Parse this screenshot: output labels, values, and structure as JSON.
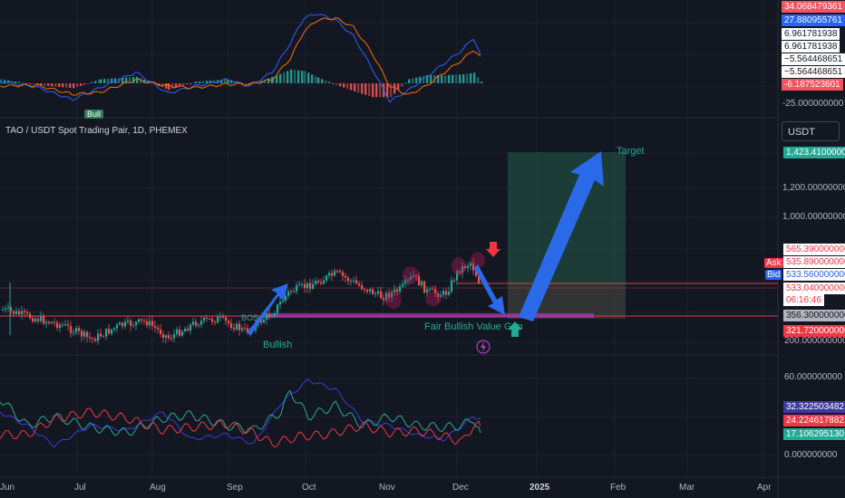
{
  "symbol_title": "TAO / USDT Spot Trading Pair, 1D, PHEMEX",
  "currency_button": "USDT",
  "macd_axis_tick": "-25.000000000",
  "price_axis_ticks": [
    "1,200.000000000",
    "1,000.000000000",
    "200.000000000"
  ],
  "rsi_axis_ticks": [
    "60.000000000",
    "0.000000000"
  ],
  "time_axis_labels": [
    "Jun",
    "Jul",
    "Aug",
    "Sep",
    "Oct",
    "Nov",
    "Dec",
    "2025",
    "Feb",
    "Mar",
    "Apr"
  ],
  "macd_labels": [
    {
      "text": "34.068479361",
      "bg": "#f7525f",
      "fg": "#ffffff"
    },
    {
      "text": "27.880955761",
      "bg": "#2962ff",
      "fg": "#ffffff"
    },
    {
      "text": "6.961781938",
      "bg": "#ffffff",
      "fg": "#131722"
    },
    {
      "text": "6.961781938",
      "bg": "#ffffff",
      "fg": "#131722"
    },
    {
      "text": "−5.564468651",
      "bg": "#ffffff",
      "fg": "#131722"
    },
    {
      "text": "−5.564468651",
      "bg": "#ffffff",
      "fg": "#131722"
    },
    {
      "text": "-6.187523601",
      "bg": "#f7525f",
      "fg": "#ffffff"
    }
  ],
  "price_labels": [
    {
      "text": "1,423.410000000",
      "bg": "#22ab94",
      "fg": "#ffffff"
    },
    {
      "text": "565.390000000",
      "bg": "#ffffff",
      "fg": "#f23645"
    },
    {
      "text": "535.890000000",
      "bg": "#ffffff",
      "fg": "#f23645"
    },
    {
      "text": "533.560000000",
      "bg": "#ffffff",
      "fg": "#2962ff"
    },
    {
      "text": "533.040000000",
      "bg": "#ffffff",
      "fg": "#f23645"
    },
    {
      "text": "06:16:46",
      "bg": "#ffffff",
      "fg": "#f23645"
    },
    {
      "text": "356.300000000",
      "bg": "#b2b5be",
      "fg": "#131722"
    },
    {
      "text": "321.720000000",
      "bg": "#f23645",
      "fg": "#ffffff"
    }
  ],
  "ask_tag": "Ask",
  "bid_tag": "Bid",
  "rsi_labels": [
    {
      "text": "32.322503482",
      "bg": "#3d3a9e",
      "fg": "#ffffff"
    },
    {
      "text": "24.224617882",
      "bg": "#f23645",
      "fg": "#ffffff"
    },
    {
      "text": "17.106295130",
      "bg": "#22ab94",
      "fg": "#ffffff"
    }
  ],
  "annotations": {
    "bull": "Bull",
    "target": "Target",
    "bos": "BOS",
    "bullish": "Bullish",
    "fair_value_gap": "Fair Bullish Value Gap"
  },
  "colors": {
    "up": "#26a69a",
    "down": "#ef5350",
    "macd_line": "#2962ff",
    "signal_line": "#ff6d00",
    "target_zone": "#1f4a3f",
    "arrow": "#2a6ae8"
  },
  "icons": [
    "lightning-icon",
    "down-arrow-icon",
    "up-arrow-icon"
  ]
}
